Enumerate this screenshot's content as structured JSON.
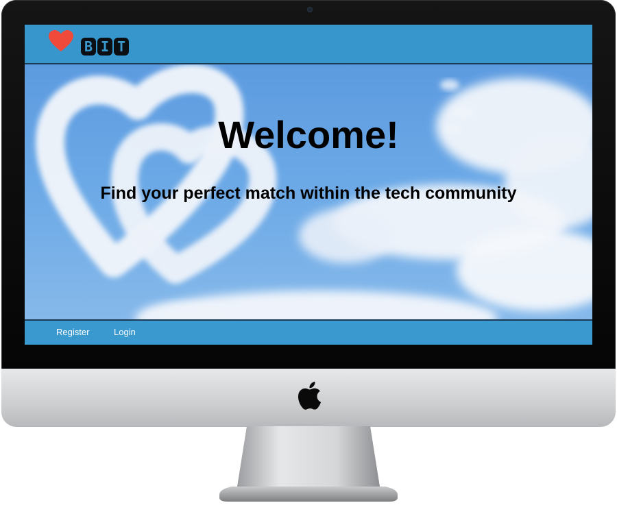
{
  "header": {
    "logo_icon": "heart-icon",
    "logo_letters": [
      "B",
      "I",
      "T"
    ],
    "brand_color": "#3a9ad0",
    "heart_color": "#f04a3a"
  },
  "hero": {
    "title": "Welcome!",
    "subtitle": "Find your perfect match within the tech community",
    "background": "sky-with-heart-clouds"
  },
  "footer_nav": {
    "register_label": "Register",
    "login_label": "Login"
  },
  "device": {
    "frame": "desktop-monitor",
    "logo_icon": "apple-icon"
  }
}
